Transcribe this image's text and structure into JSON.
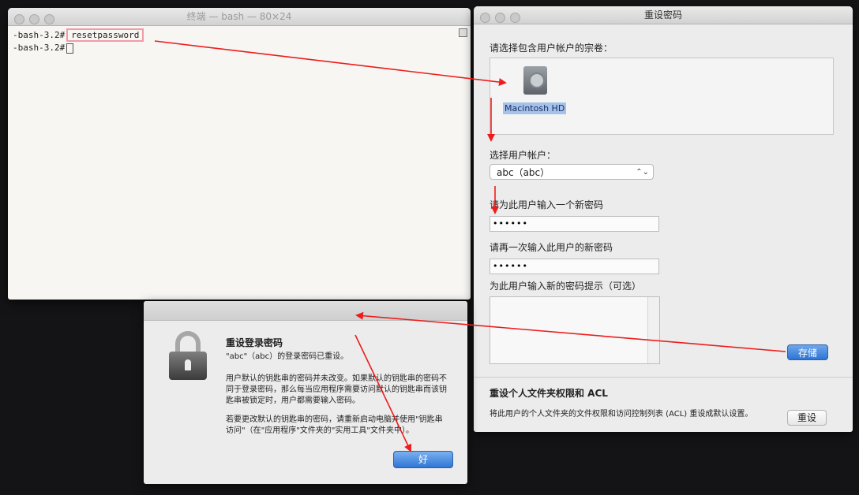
{
  "terminal": {
    "title": "终端 — bash — 80×24",
    "lines": [
      {
        "prompt": "-bash-3.2#",
        "command": "resetpassword"
      },
      {
        "prompt": "-bash-3.2#",
        "command": ""
      }
    ]
  },
  "reset_window": {
    "title": "重设密码",
    "volume_label": "请选择包含用户帐户的宗卷：",
    "volume_name": "Macintosh HD",
    "account_label": "选择用户帐户：",
    "account_value": "abc（abc）",
    "new_password_label": "请为此用户输入一个新密码",
    "new_password_value": "••••••",
    "confirm_password_label": "请再一次输入此用户的新密码",
    "confirm_password_value": "••••••",
    "hint_label": "为此用户输入新的密码提示（可选）",
    "save_button": "存储",
    "acl_heading": "重设个人文件夹权限和 ACL",
    "acl_description": "将此用户的个人文件夹的文件权限和访问控制列表 (ACL) 重设成默认设置。",
    "reset_button": "重设"
  },
  "alert": {
    "title": "重设登录密码",
    "line1": "\"abc\"（abc）的登录密码已重设。",
    "paragraph1": "用户默认的钥匙串的密码并未改变。如果默认的钥匙串的密码不同于登录密码，那么每当应用程序需要访问默认的钥匙串而该钥匙串被锁定时，用户都需要输入密码。",
    "paragraph2": "若要更改默认的钥匙串的密码，请重新启动电脑并使用\"钥匙串访问\"（在\"应用程序\"文件夹的\"实用工具\"文件夹中）。",
    "ok_button": "好"
  },
  "colors": {
    "annotation_arrow": "#ee1c1c",
    "command_highlight": "#f29aa8",
    "primary_button": "#2d74d4"
  }
}
